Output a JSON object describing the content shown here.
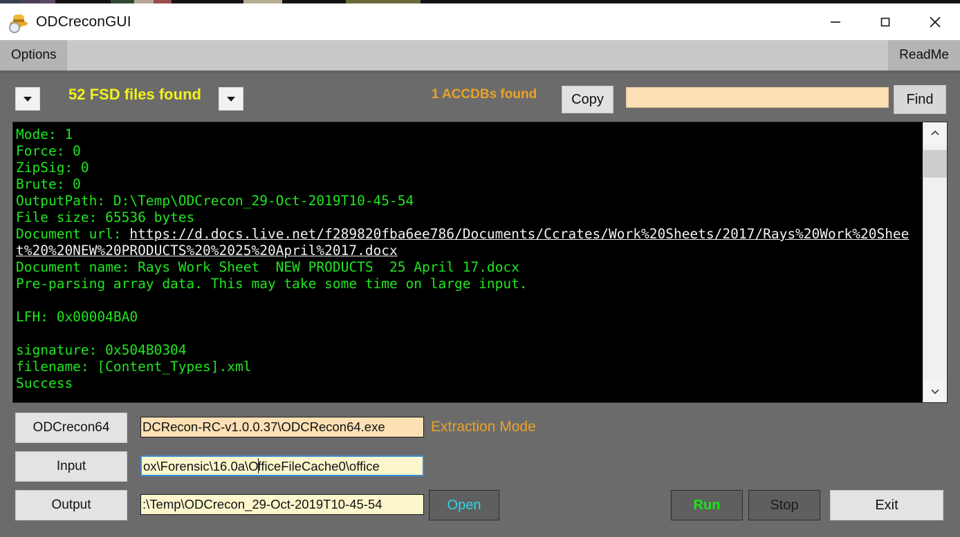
{
  "window": {
    "title": "ODCreconGUI",
    "icon": "detective-hat-magnifier-icon",
    "minimize_label": "—",
    "maximize_label": "□",
    "close_label": "✕"
  },
  "menubar": {
    "items": [
      {
        "label": "Options",
        "name": "menu-item-options"
      },
      {
        "label": "ReadMe",
        "name": "menu-item-readme"
      }
    ]
  },
  "toolbar": {
    "left_combo_caret": "▼",
    "fsd_status": "52 FSD files found",
    "right_combo_caret": "▼",
    "accdb_status": "1 ACCDBs found",
    "copy_label": "Copy",
    "find_value": "",
    "find_placeholder": "",
    "find_label": "Find"
  },
  "console": {
    "lines": [
      {
        "text": "Mode: 1",
        "type": "text"
      },
      {
        "text": "Force: 0",
        "type": "text"
      },
      {
        "text": "ZipSig: 0",
        "type": "text"
      },
      {
        "text": "Brute: 0",
        "type": "text"
      },
      {
        "text": "OutputPath: D:\\Temp\\ODCrecon_29-Oct-2019T10-45-54",
        "type": "text"
      },
      {
        "text": "File size: 65536 bytes",
        "type": "text"
      },
      {
        "text": "Document url: ",
        "type": "text-with-link",
        "link": "https://d.docs.live.net/f289820fba6ee786/Documents/Ccrates/Work%20Sheets/2017/Rays%20Work%20Sheet%20%20NEW%20PRODUCTS%20%2025%20April%2017.docx"
      },
      {
        "text": "Document name: Rays Work Sheet  NEW PRODUCTS  25 April 17.docx",
        "type": "text"
      },
      {
        "text": "Pre-parsing array data. This may take some time on large input.",
        "type": "text"
      },
      {
        "text": "",
        "type": "text"
      },
      {
        "text": "LFH: 0x00004BA0",
        "type": "text"
      },
      {
        "text": "",
        "type": "text"
      },
      {
        "text": "signature: 0x504B0304",
        "type": "text"
      },
      {
        "text": "filename: [Content_Types].xml",
        "type": "text"
      },
      {
        "text": "Success",
        "type": "text"
      }
    ],
    "scroll_up_icon": "chevron-up-icon",
    "scroll_down_icon": "chevron-down-icon"
  },
  "rows": {
    "exe": {
      "button_label": "ODCrecon64",
      "field_value": "DCRecon-RC-v1.0.0.37\\ODCRecon64.exe",
      "mode_label": "Extraction Mode"
    },
    "input": {
      "button_label": "Input",
      "field_value_before_caret": "ox\\Forensic\\16.0a\\O",
      "field_value_after_caret": "fficeFileCache0\\office"
    },
    "output": {
      "button_label": "Output",
      "field_value": ":\\Temp\\ODCrecon_29-Oct-2019T10-45-54",
      "open_label": "Open"
    }
  },
  "actions": {
    "run_label": "Run",
    "stop_label": "Stop",
    "exit_label": "Exit"
  },
  "colors": {
    "window_bg": "#6b6b6b",
    "console_bg": "#000000",
    "console_fg": "#21e521",
    "yellow_status": "#f2f21c",
    "orange_status": "#e9a227",
    "field_peach": "#fde0b4",
    "field_pale": "#fdf6cd",
    "run_green": "#17e617",
    "open_cyan": "#2fd6e8"
  }
}
